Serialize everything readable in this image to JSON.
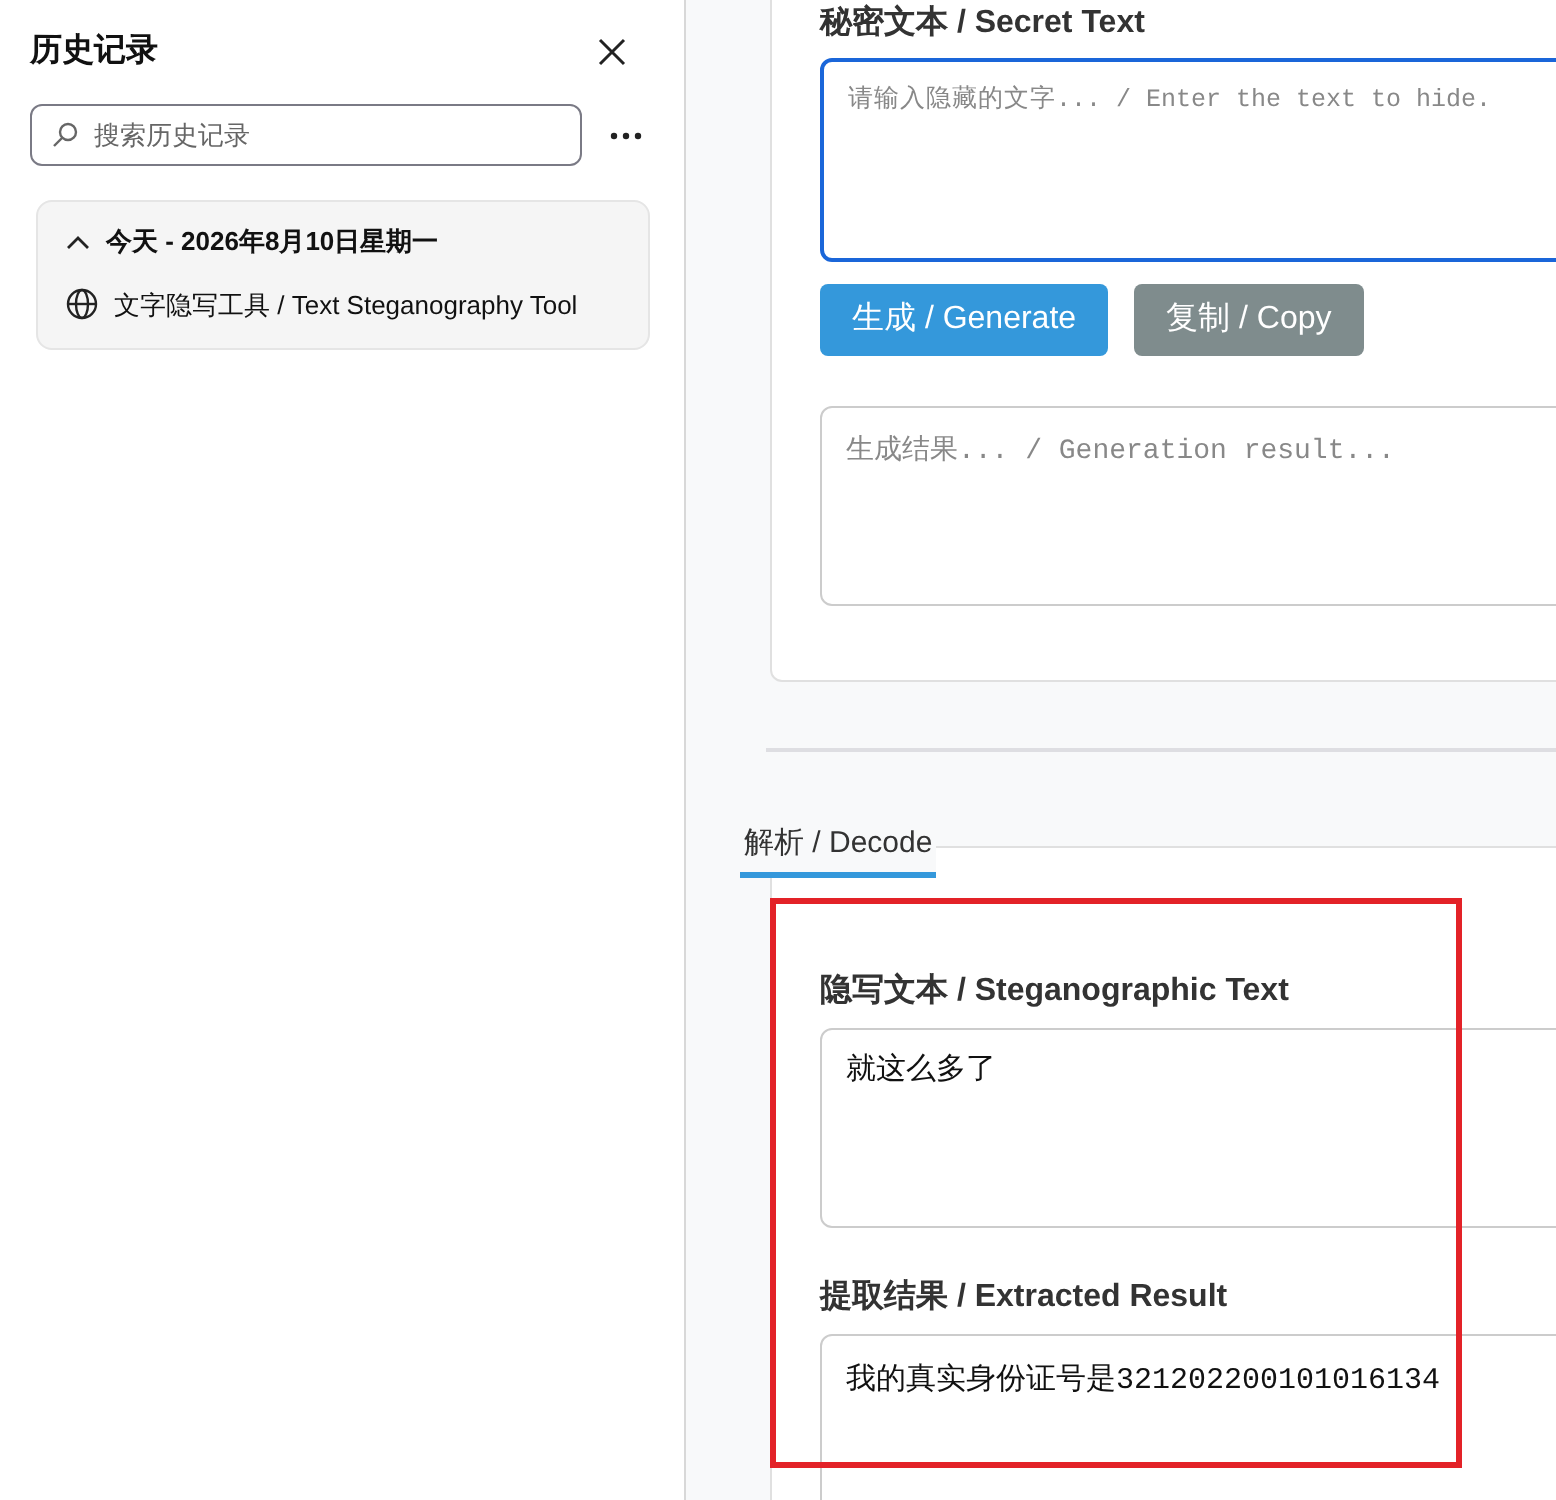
{
  "sidebar": {
    "title": "历史记录",
    "search": {
      "placeholder": "搜索历史记录"
    },
    "groups": [
      {
        "label": "今天 - 2026年8月10日星期一",
        "expanded": true,
        "items": [
          {
            "label": "文字隐写工具 / Text Steganography Tool"
          }
        ]
      }
    ]
  },
  "encode": {
    "label": "秘密文本 / Secret Text",
    "input": {
      "placeholder": "请输入隐藏的文字... / Enter the text to hide.",
      "focused": true
    },
    "buttons": [
      {
        "label": "生成 / Generate",
        "kind": "primary"
      },
      {
        "label": "复制 / Copy",
        "kind": "secondary"
      }
    ],
    "result": {
      "placeholder": "生成结果... / Generation result..."
    }
  },
  "tabs": [
    {
      "label": "解析 / Decode",
      "selected": true
    }
  ],
  "decode": {
    "input_label": "隐写文本 / Steganographic Text",
    "input_value": "就这么多了",
    "result_label": "提取结果 / Extracted Result",
    "result_value": "我的真实身份证号是321202200101016134"
  }
}
